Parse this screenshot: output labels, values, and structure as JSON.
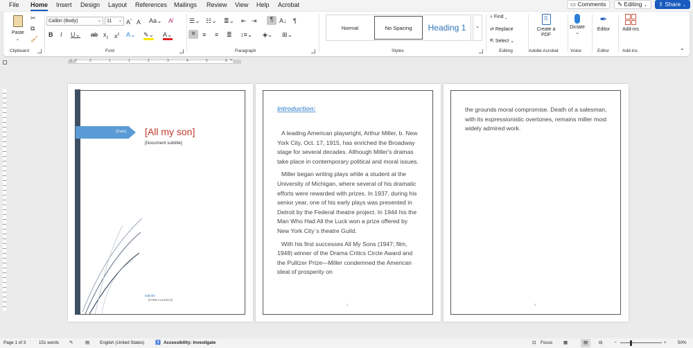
{
  "menu": {
    "tabs": [
      "File",
      "Home",
      "Insert",
      "Design",
      "Layout",
      "References",
      "Mailings",
      "Review",
      "View",
      "Help",
      "Acrobat"
    ],
    "active": "Home"
  },
  "topright": {
    "comments": "Comments",
    "editing": "Editing",
    "share": "Share"
  },
  "ribbon": {
    "clipboard": {
      "label": "Clipboard",
      "paste": "Paste"
    },
    "font": {
      "label": "Font",
      "name": "Calibri (Body)",
      "size": "11"
    },
    "paragraph": {
      "label": "Paragraph"
    },
    "styles": {
      "label": "Styles",
      "items": [
        "Normal",
        "No Spacing",
        "Heading 1"
      ]
    },
    "editing": {
      "label": "Editing",
      "find": "Find",
      "replace": "Replace",
      "select": "Select"
    },
    "acrobat": {
      "label": "Adobe Acrobat",
      "create": "Create a PDF"
    },
    "voice": {
      "label": "Voice",
      "dictate": "Dictate"
    },
    "editor": {
      "label": "Editor",
      "editor": "Editor"
    },
    "addins": {
      "label": "Add-ins",
      "addins": "Add-ins"
    }
  },
  "ruler": {
    "marks": [
      "1",
      "2",
      "1",
      "1",
      "2",
      "3",
      "4",
      "5",
      "6"
    ]
  },
  "doc": {
    "cover": {
      "date": "[Date]",
      "title": "[All my son]",
      "subtitle": "[Document subtitle]",
      "author": "sabri33",
      "company": "[FORM CLASSICS]"
    },
    "page2": {
      "heading": "Introduction:",
      "paragraphs": [
        "A leading American playwright, Arthur Miller, b. New York City, Oct. 17, 1915, has enriched the Broadway stage for several decades. Although Miller's dramas take place in contemporary political and moral issues.",
        "Miller began writing plays while a student at the University of Michigan, where several of his dramatic efforts were rewarded with prizes. In 1937, during his senior year, one of his early plays was presented in Detroit by the Federal theatre project. In 1944 his the Man Who Had All the Luck won a prize offered by New York City`s theatre Guild.",
        "With his first successes All My Sons (1947; film, 1948) winner of the Drama Critics Circle Award and the Pulitzer Prize—Miller condemned the American ideal of prosperity on"
      ],
      "page_number": "1"
    },
    "page3": {
      "text": "the grounds moral compromise. Death of a salesman, with its expressionistic overtones, remains miller most widely admired work.",
      "page_number": "2"
    }
  },
  "status": {
    "page": "Page 1 of 3",
    "words": "151 words",
    "language": "English (United States)",
    "accessibility": "Accessibility: Investigate",
    "focus": "Focus",
    "zoom": "50%"
  },
  "colors": {
    "accent": "#185abd",
    "cover_bar": "#3f4f63",
    "cover_arrow": "#5b9bd5",
    "cover_title": "#c0392b"
  }
}
